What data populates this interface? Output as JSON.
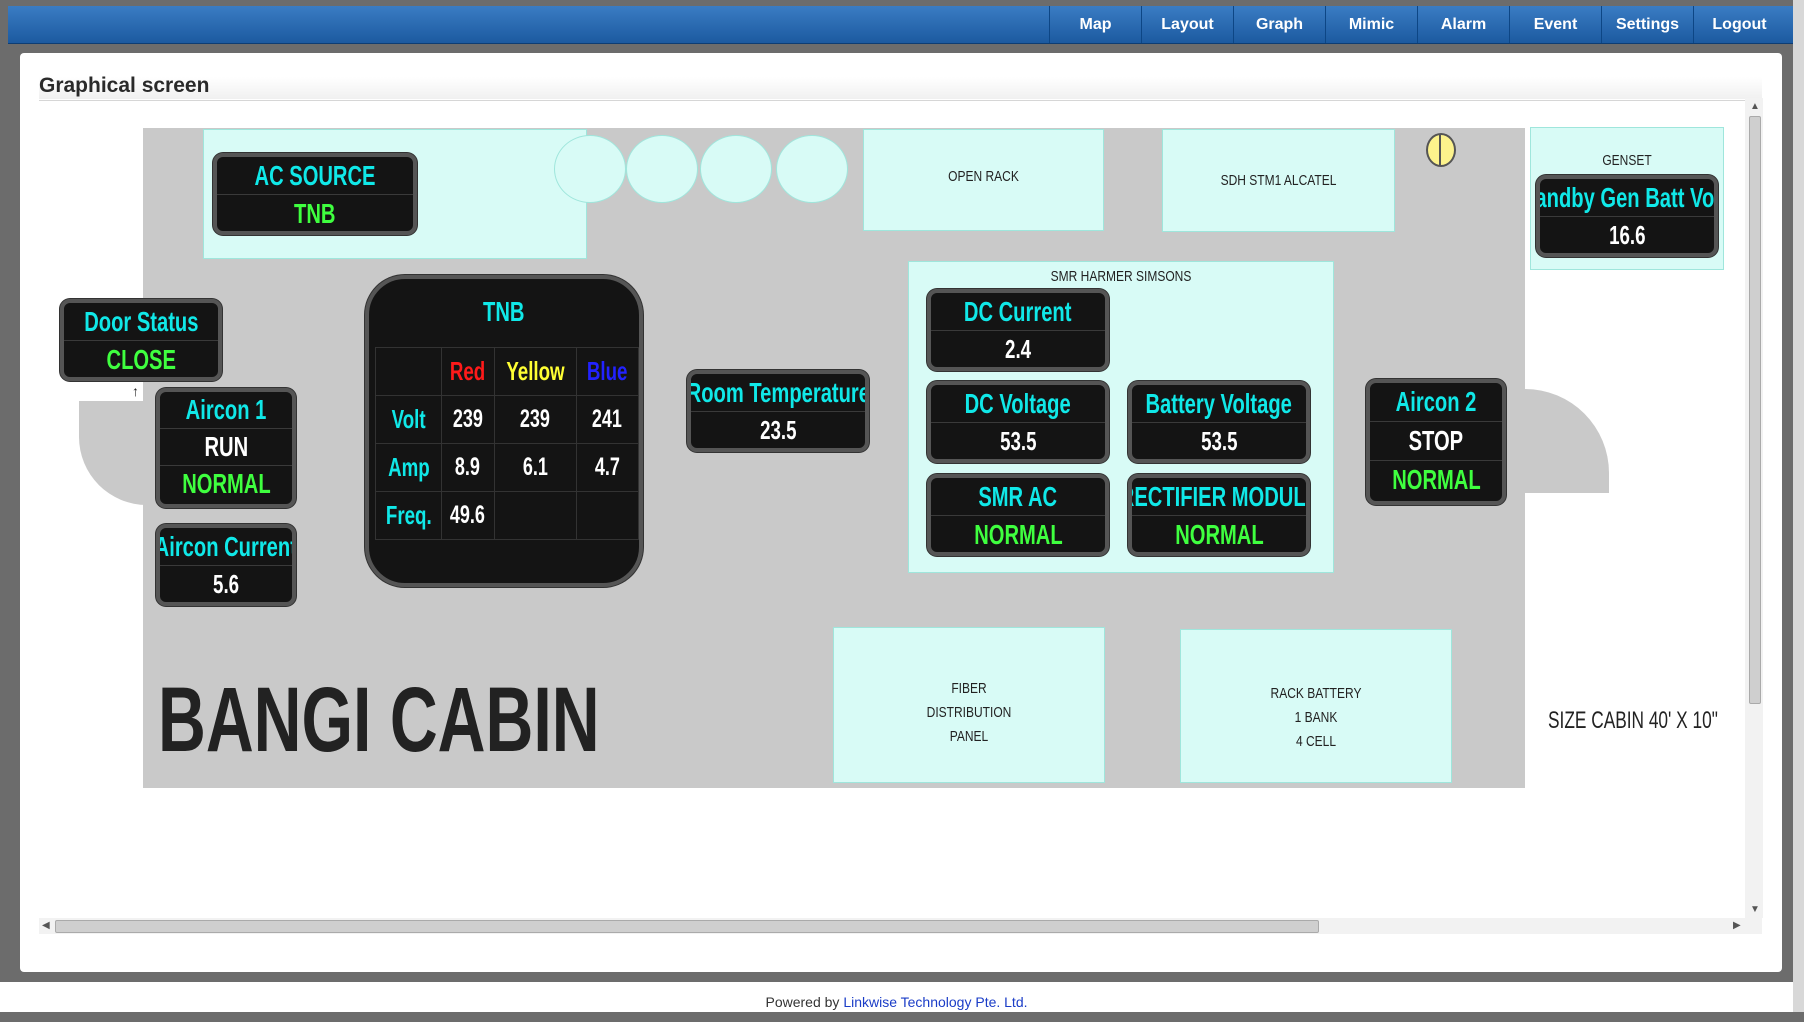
{
  "nav": {
    "items": [
      "Map",
      "Layout",
      "Graph",
      "Mimic",
      "Alarm",
      "Event",
      "Settings",
      "Logout"
    ]
  },
  "page": {
    "title": "Graphical screen"
  },
  "areas": {
    "open_rack": "OPEN RACK",
    "sdh": "SDH STM1 ALCATEL",
    "genset": "GENSET",
    "smr": "SMR HARMER SIMSONS",
    "fiber": [
      "FIBER",
      "DISTRIBUTION",
      "PANEL"
    ],
    "battery": [
      "RACK BATTERY",
      "1 BANK",
      "4 CELL"
    ]
  },
  "widgets": {
    "ac_source": {
      "label": "AC SOURCE",
      "value": "TNB"
    },
    "door_status": {
      "label": "Door Status",
      "value": "CLOSE"
    },
    "aircon1": {
      "label": "Aircon 1",
      "state": "RUN",
      "status": "NORMAL"
    },
    "aircon_current": {
      "label": "Aircon Current",
      "value": "5.6"
    },
    "room_temp": {
      "label": "Room Temperature",
      "value": "23.5"
    },
    "dc_current": {
      "label": "DC Current",
      "value": "2.4"
    },
    "dc_voltage": {
      "label": "DC Voltage",
      "value": "53.5"
    },
    "battery_voltage": {
      "label": "Battery Voltage",
      "value": "53.5"
    },
    "smr_ac": {
      "label": "SMR AC",
      "value": "NORMAL"
    },
    "rectifier": {
      "label": "RECTIFIER MODULE",
      "value": "NORMAL"
    },
    "aircon2": {
      "label": "Aircon 2",
      "state": "STOP",
      "status": "NORMAL"
    },
    "standby_gen": {
      "label": "Standby Gen Batt Volts",
      "value": "16.6"
    }
  },
  "tnb": {
    "title": "TNB",
    "phases": [
      "Red",
      "Yellow",
      "Blue"
    ],
    "phase_colors": [
      "#ff1a1a",
      "#ffff33",
      "#2222ff"
    ],
    "rows": [
      {
        "label": "Volt",
        "values": [
          "239",
          "239",
          "241"
        ]
      },
      {
        "label": "Amp",
        "values": [
          "8.9",
          "6.1",
          "4.7"
        ]
      },
      {
        "label": "Freq.",
        "values": [
          "49.6",
          "",
          ""
        ]
      }
    ]
  },
  "site": {
    "name": "BANGI CABIN",
    "size": "SIZE CABIN 40' X 10\""
  },
  "footer": {
    "prefix": "Powered by ",
    "link": "Linkwise Technology Pte. Ltd."
  }
}
